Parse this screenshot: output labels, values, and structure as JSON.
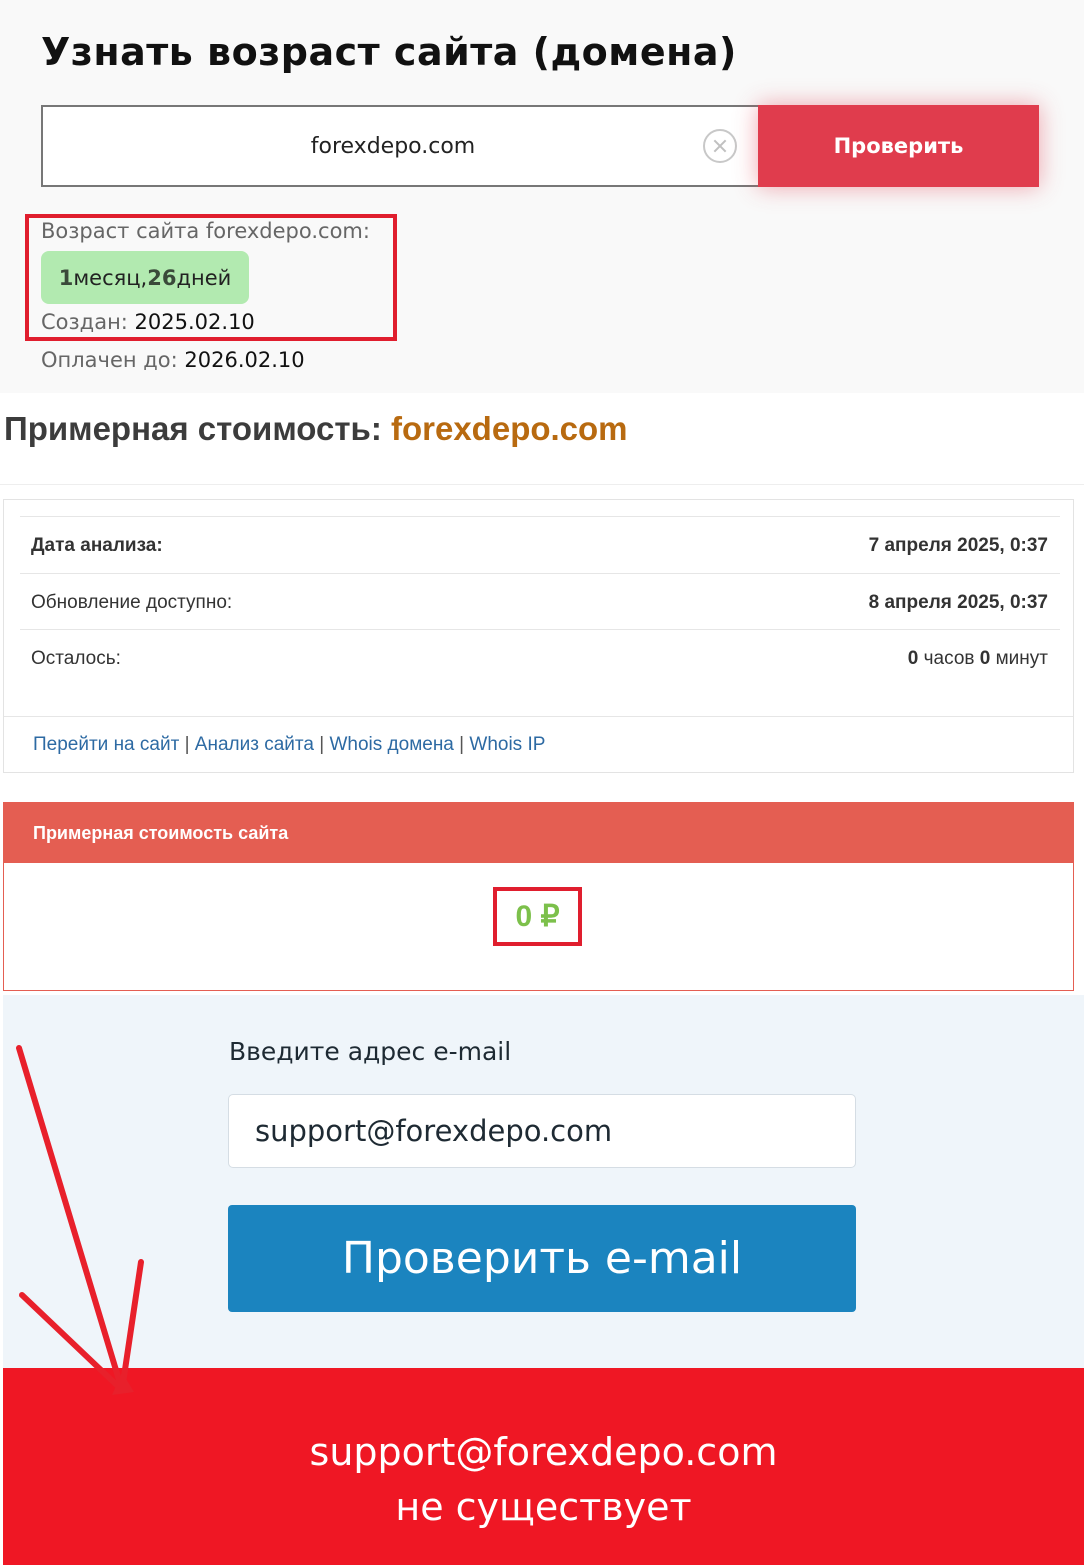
{
  "age": {
    "title": "Узнать возраст сайта (домена)",
    "input_value": "forexdepo.com",
    "check_label": "Проверить",
    "result_label": "Возраст сайта forexdepo.com:",
    "age_months_num": "1",
    "age_months_word": " месяц, ",
    "age_days_num": "26",
    "age_days_word": " дней",
    "created_label": "Создан: ",
    "created_value": "2025.02.10",
    "paid_label": "Оплачен до: ",
    "paid_value": "2026.02.10"
  },
  "price": {
    "title_prefix": "Примерная стоимость: ",
    "title_domain": "forexdepo.com",
    "rows": [
      {
        "label": "Дата анализа:",
        "value": "7 апреля 2025, 0:37"
      },
      {
        "label": "Обновление доступно:",
        "value": "8 апреля 2025, 0:37"
      },
      {
        "label": "Осталось:",
        "hours_num": "0",
        "hours_word": " часов ",
        "minutes_num": "0",
        "minutes_word": " минут"
      }
    ],
    "links": [
      "Перейти на сайт",
      "Анализ сайта",
      "Whois домена",
      "Whois IP"
    ],
    "link_separator": " | ",
    "card_title": "Примерная стоимость сайта",
    "card_value": "0 ₽"
  },
  "email": {
    "label": "Введите адрес e-mail",
    "input_value": "support@forexdepo.com",
    "button_label": "Проверить e-mail",
    "result_line1": "support@forexdepo.com",
    "result_line2": "не существует"
  },
  "colors": {
    "check_button": "#e03c4d",
    "highlight_border": "#e01e2e",
    "age_badge": "#b2eab0",
    "domain_orange": "#b86a10",
    "card_header": "#e45e52",
    "price_green": "#7cc04b",
    "email_button": "#1b84bf",
    "result_banner": "#ef1724",
    "annotation_arrow": "#e8202b"
  }
}
